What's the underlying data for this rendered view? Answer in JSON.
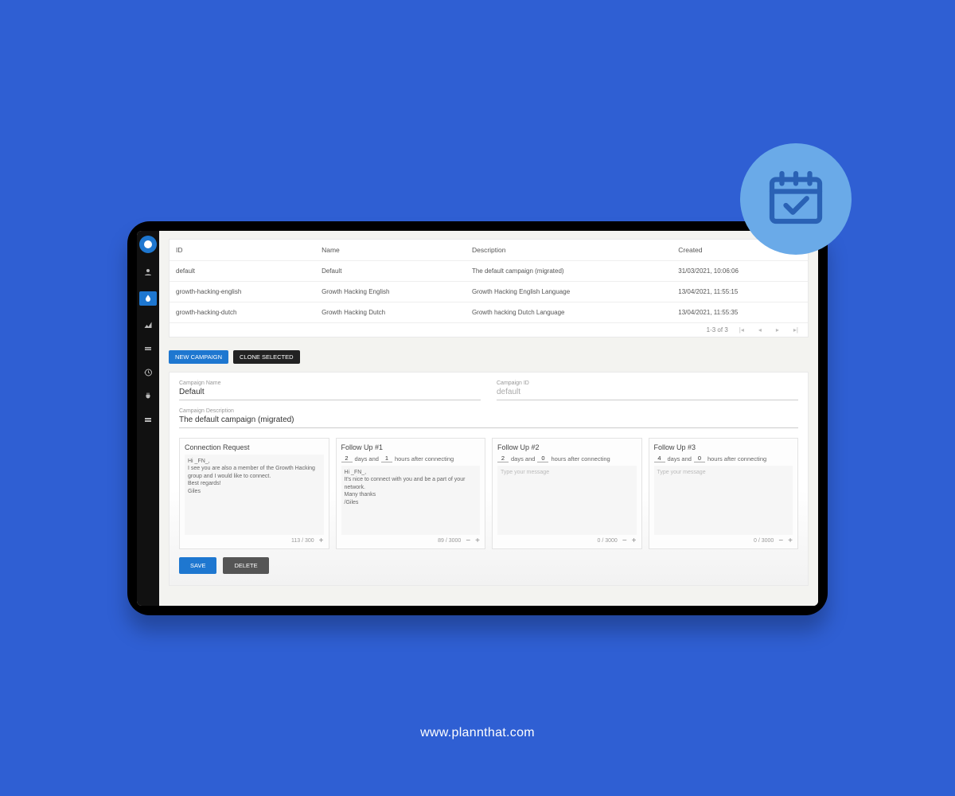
{
  "colors": {
    "page_bg": "#2f5fd3",
    "accent": "#1e77d0",
    "badge": "#6aaae8"
  },
  "badge_icon": "calendar-check-icon",
  "site_url": "www.plannthat.com",
  "sidebar": {
    "items": [
      {
        "icon": "person-icon"
      },
      {
        "icon": "droplet-icon",
        "active": true
      },
      {
        "icon": "chart-icon"
      },
      {
        "icon": "layers-icon"
      },
      {
        "icon": "history-icon"
      },
      {
        "icon": "plug-icon"
      },
      {
        "icon": "grid-icon"
      }
    ]
  },
  "table": {
    "headers": {
      "id": "ID",
      "name": "Name",
      "description": "Description",
      "created": "Created"
    },
    "rows": [
      {
        "id": "default",
        "name": "Default",
        "description": "The default campaign (migrated)",
        "created": "31/03/2021, 10:06:06"
      },
      {
        "id": "growth-hacking-english",
        "name": "Growth Hacking English",
        "description": "Growth Hacking English Language",
        "created": "13/04/2021, 11:55:15"
      },
      {
        "id": "growth-hacking-dutch",
        "name": "Growth Hacking Dutch",
        "description": "Growth hacking Dutch Language",
        "created": "13/04/2021, 11:55:35"
      }
    ],
    "pagination": "1-3 of 3"
  },
  "buttons": {
    "new_campaign": "NEW CAMPAIGN",
    "clone_selected": "CLONE SELECTED",
    "save": "SAVE",
    "delete": "DELETE"
  },
  "form": {
    "name_label": "Campaign Name",
    "name_value": "Default",
    "id_label": "Campaign ID",
    "id_value": "default",
    "desc_label": "Campaign Description",
    "desc_value": "The default campaign (migrated)"
  },
  "timing_labels": {
    "days_and": "days and",
    "hours_after": "hours after connecting"
  },
  "placeholder_msg": "Type your message",
  "cards": [
    {
      "title": "Connection Request",
      "message": "Hi _FN_,\nI see you are also a member of the Growth Hacking group and I would like to connect.\nBest regards!\nGiles",
      "counter": "113 / 300"
    },
    {
      "title": "Follow Up #1",
      "days": "2",
      "hours": "1",
      "message": "Hi _FN_,\nIt's nice to connect with you and be a part of your network.\nMany thanks\n/Giles",
      "counter": "89 / 3000"
    },
    {
      "title": "Follow Up #2",
      "days": "2",
      "hours": "0",
      "message": "",
      "counter": "0 / 3000"
    },
    {
      "title": "Follow Up #3",
      "days": "4",
      "hours": "0",
      "message": "",
      "counter": "0 / 3000"
    }
  ]
}
